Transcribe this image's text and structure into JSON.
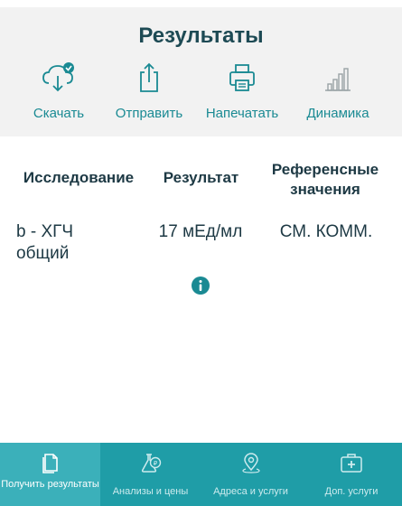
{
  "header": {
    "title": "Результаты",
    "actions": [
      {
        "label": "Скачать",
        "icon": "cloud-download-icon"
      },
      {
        "label": "Отправить",
        "icon": "share-icon"
      },
      {
        "label": "Напечатать",
        "icon": "printer-icon"
      },
      {
        "label": "Динамика",
        "icon": "bar-chart-icon"
      }
    ]
  },
  "table": {
    "columns": [
      "Исследование",
      "Результат",
      "Референсные значения"
    ],
    "rows": [
      {
        "test": "b - ХГЧ общий",
        "result": "17 мЕд/мл",
        "reference": "СМ. КОММ."
      }
    ]
  },
  "tabbar": {
    "tabs": [
      {
        "label": "Получить результаты",
        "icon": "document-icon",
        "active": true
      },
      {
        "label": "Анализы и цены",
        "icon": "flask-icon",
        "active": false
      },
      {
        "label": "Адреса и услуги",
        "icon": "map-pin-icon",
        "active": false
      },
      {
        "label": "Доп. услуги",
        "icon": "medical-kit-icon",
        "active": false
      }
    ]
  },
  "colors": {
    "accent": "#1a8a93",
    "tabbar": "#1f9da7",
    "tab_active": "#3bb0ba",
    "header_bg": "#f2f2f2",
    "title": "#1d4a54"
  }
}
